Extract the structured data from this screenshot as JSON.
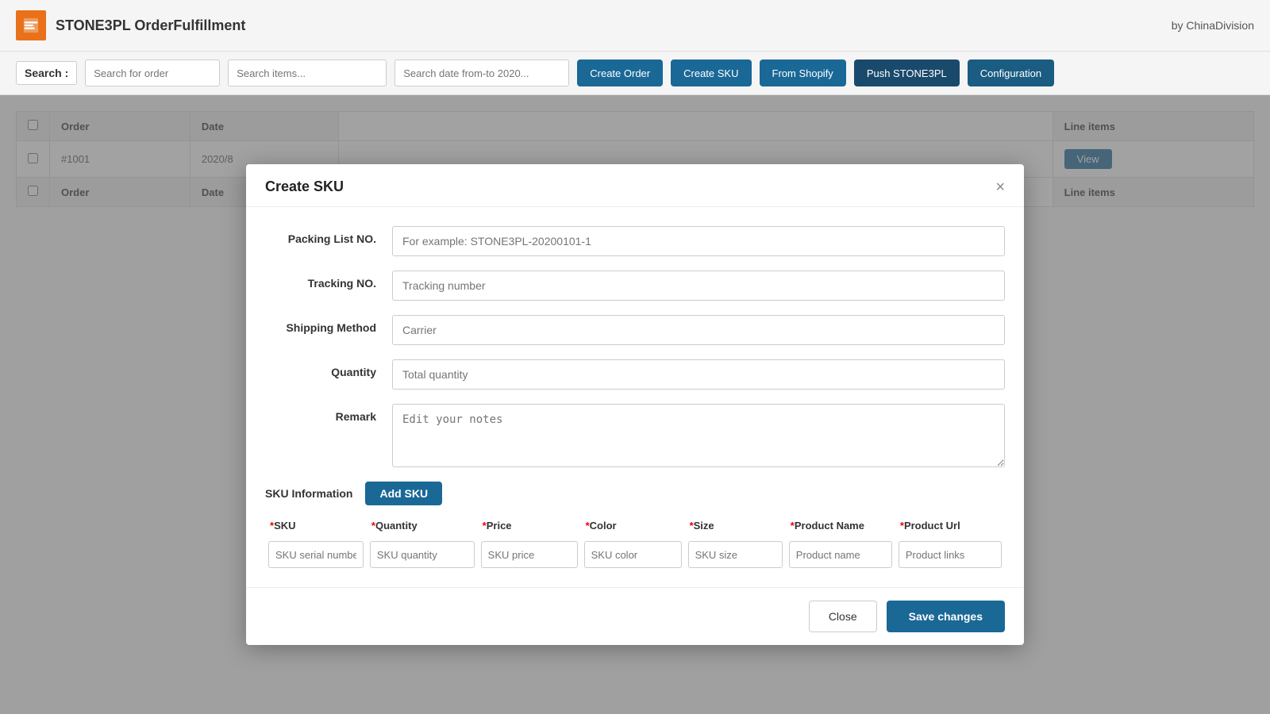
{
  "topbar": {
    "logo_alt": "STONE3PL logo",
    "app_title": "STONE3PL OrderFulfillment",
    "byline": "by ChinaDivision"
  },
  "toolbar": {
    "search_label": "Search :",
    "search_placeholder": "Search for order",
    "btn1": "Create Order",
    "btn2": "Create SKU",
    "btn3": "From Shopify",
    "btn4": "Push STONE3PL",
    "btn_config": "Configuration"
  },
  "table": {
    "headers": [
      "",
      "Order",
      "Date",
      "Line items"
    ],
    "rows": [
      {
        "order": "#1001",
        "date": "2020/8",
        "line_items": ""
      },
      {
        "order": "",
        "date": "",
        "line_items": ""
      }
    ],
    "view_btn": "View",
    "col2_headers": [
      "",
      "Order",
      "Date",
      "Line items"
    ]
  },
  "modal": {
    "title": "Create SKU",
    "close_btn": "×",
    "fields": {
      "packing_list_label": "Packing List NO.",
      "packing_list_placeholder": "For example: STONE3PL-20200101-1",
      "tracking_no_label": "Tracking NO.",
      "tracking_no_placeholder": "Tracking number",
      "shipping_method_label": "Shipping Method",
      "shipping_method_placeholder": "Carrier",
      "quantity_label": "Quantity",
      "quantity_placeholder": "Total quantity",
      "remark_label": "Remark",
      "remark_placeholder": "Edit your notes"
    },
    "sku_section": {
      "label": "SKU Information",
      "add_btn": "Add SKU",
      "columns": [
        {
          "header": "*SKU",
          "placeholder": "SKU serial number"
        },
        {
          "header": "*Quantity",
          "placeholder": "SKU quantity"
        },
        {
          "header": "*Price",
          "placeholder": "SKU price"
        },
        {
          "header": "*Color",
          "placeholder": "SKU color"
        },
        {
          "header": "*Size",
          "placeholder": "SKU size"
        },
        {
          "header": "*Product Name",
          "placeholder": "Product name"
        },
        {
          "header": "*Product Url",
          "placeholder": "Product links"
        }
      ]
    },
    "footer": {
      "close_btn": "Close",
      "save_btn": "Save changes"
    }
  }
}
